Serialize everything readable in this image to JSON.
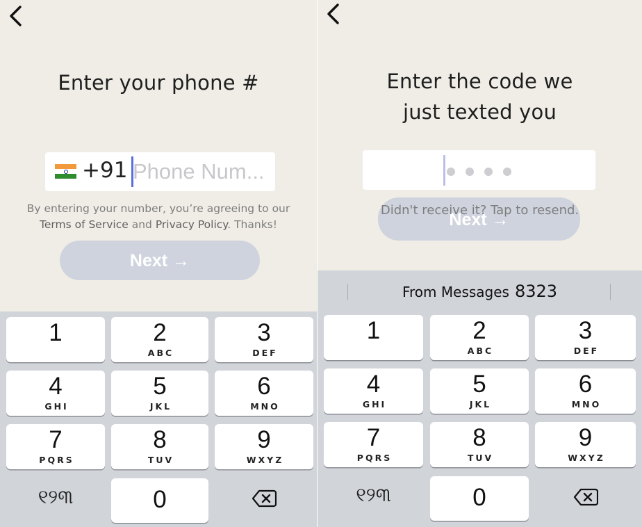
{
  "left_screen": {
    "title": "Enter your phone #",
    "phone": {
      "country_code": "+91",
      "placeholder": "Phone Num...",
      "value": ""
    },
    "terms": {
      "line1": "By entering your number, you’re agreeing to our",
      "terms_link": "Terms of Service",
      "and": "and",
      "privacy_link": "Privacy Policy",
      "thanks": ". Thanks!"
    },
    "next_label": "Next →"
  },
  "right_screen": {
    "title_line1": "Enter the code we",
    "title_line2": "just texted you",
    "resend": "Didn't receive it? Tap to resend.",
    "next_label": "Next →",
    "suggestion": {
      "source": "From Messages",
      "code": "8323"
    }
  },
  "keyboard": {
    "keys": [
      {
        "num": "1",
        "letters": ""
      },
      {
        "num": "2",
        "letters": "ABC"
      },
      {
        "num": "3",
        "letters": "DEF"
      },
      {
        "num": "4",
        "letters": "GHI"
      },
      {
        "num": "5",
        "letters": "JKL"
      },
      {
        "num": "6",
        "letters": "MNO"
      },
      {
        "num": "7",
        "letters": "PQRS"
      },
      {
        "num": "8",
        "letters": "TUV"
      },
      {
        "num": "9",
        "letters": "WXYZ"
      },
      {
        "num": "0",
        "letters": ""
      }
    ],
    "lang_key": "୧୨୩",
    "delete_icon": "backspace-icon"
  },
  "icons": {
    "back": "chevron-left-icon",
    "flag": "india-flag-icon"
  },
  "colors": {
    "background": "#f0ede6",
    "button_disabled": "#cfd3dd",
    "caret": "#5a6de0",
    "keyboard_bg": "#d1d4d9"
  }
}
